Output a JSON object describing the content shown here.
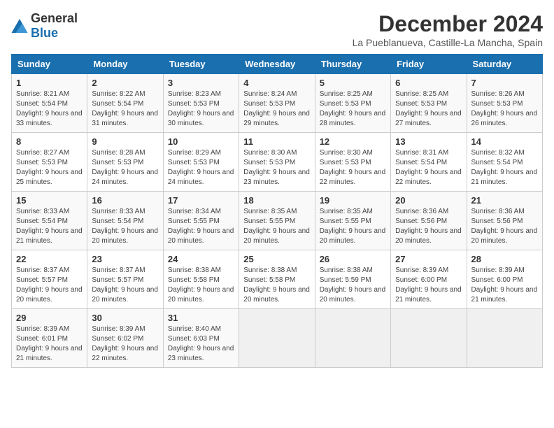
{
  "logo": {
    "general": "General",
    "blue": "Blue"
  },
  "header": {
    "title": "December 2024",
    "subtitle": "La Pueblanueva, Castille-La Mancha, Spain"
  },
  "weekdays": [
    "Sunday",
    "Monday",
    "Tuesday",
    "Wednesday",
    "Thursday",
    "Friday",
    "Saturday"
  ],
  "weeks": [
    [
      {
        "day": "1",
        "sunrise": "8:21 AM",
        "sunset": "5:54 PM",
        "daylight": "9 hours and 33 minutes."
      },
      {
        "day": "2",
        "sunrise": "8:22 AM",
        "sunset": "5:54 PM",
        "daylight": "9 hours and 31 minutes."
      },
      {
        "day": "3",
        "sunrise": "8:23 AM",
        "sunset": "5:53 PM",
        "daylight": "9 hours and 30 minutes."
      },
      {
        "day": "4",
        "sunrise": "8:24 AM",
        "sunset": "5:53 PM",
        "daylight": "9 hours and 29 minutes."
      },
      {
        "day": "5",
        "sunrise": "8:25 AM",
        "sunset": "5:53 PM",
        "daylight": "9 hours and 28 minutes."
      },
      {
        "day": "6",
        "sunrise": "8:25 AM",
        "sunset": "5:53 PM",
        "daylight": "9 hours and 27 minutes."
      },
      {
        "day": "7",
        "sunrise": "8:26 AM",
        "sunset": "5:53 PM",
        "daylight": "9 hours and 26 minutes."
      }
    ],
    [
      {
        "day": "8",
        "sunrise": "8:27 AM",
        "sunset": "5:53 PM",
        "daylight": "9 hours and 25 minutes."
      },
      {
        "day": "9",
        "sunrise": "8:28 AM",
        "sunset": "5:53 PM",
        "daylight": "9 hours and 24 minutes."
      },
      {
        "day": "10",
        "sunrise": "8:29 AM",
        "sunset": "5:53 PM",
        "daylight": "9 hours and 24 minutes."
      },
      {
        "day": "11",
        "sunrise": "8:30 AM",
        "sunset": "5:53 PM",
        "daylight": "9 hours and 23 minutes."
      },
      {
        "day": "12",
        "sunrise": "8:30 AM",
        "sunset": "5:53 PM",
        "daylight": "9 hours and 22 minutes."
      },
      {
        "day": "13",
        "sunrise": "8:31 AM",
        "sunset": "5:54 PM",
        "daylight": "9 hours and 22 minutes."
      },
      {
        "day": "14",
        "sunrise": "8:32 AM",
        "sunset": "5:54 PM",
        "daylight": "9 hours and 21 minutes."
      }
    ],
    [
      {
        "day": "15",
        "sunrise": "8:33 AM",
        "sunset": "5:54 PM",
        "daylight": "9 hours and 21 minutes."
      },
      {
        "day": "16",
        "sunrise": "8:33 AM",
        "sunset": "5:54 PM",
        "daylight": "9 hours and 20 minutes."
      },
      {
        "day": "17",
        "sunrise": "8:34 AM",
        "sunset": "5:55 PM",
        "daylight": "9 hours and 20 minutes."
      },
      {
        "day": "18",
        "sunrise": "8:35 AM",
        "sunset": "5:55 PM",
        "daylight": "9 hours and 20 minutes."
      },
      {
        "day": "19",
        "sunrise": "8:35 AM",
        "sunset": "5:55 PM",
        "daylight": "9 hours and 20 minutes."
      },
      {
        "day": "20",
        "sunrise": "8:36 AM",
        "sunset": "5:56 PM",
        "daylight": "9 hours and 20 minutes."
      },
      {
        "day": "21",
        "sunrise": "8:36 AM",
        "sunset": "5:56 PM",
        "daylight": "9 hours and 20 minutes."
      }
    ],
    [
      {
        "day": "22",
        "sunrise": "8:37 AM",
        "sunset": "5:57 PM",
        "daylight": "9 hours and 20 minutes."
      },
      {
        "day": "23",
        "sunrise": "8:37 AM",
        "sunset": "5:57 PM",
        "daylight": "9 hours and 20 minutes."
      },
      {
        "day": "24",
        "sunrise": "8:38 AM",
        "sunset": "5:58 PM",
        "daylight": "9 hours and 20 minutes."
      },
      {
        "day": "25",
        "sunrise": "8:38 AM",
        "sunset": "5:58 PM",
        "daylight": "9 hours and 20 minutes."
      },
      {
        "day": "26",
        "sunrise": "8:38 AM",
        "sunset": "5:59 PM",
        "daylight": "9 hours and 20 minutes."
      },
      {
        "day": "27",
        "sunrise": "8:39 AM",
        "sunset": "6:00 PM",
        "daylight": "9 hours and 21 minutes."
      },
      {
        "day": "28",
        "sunrise": "8:39 AM",
        "sunset": "6:00 PM",
        "daylight": "9 hours and 21 minutes."
      }
    ],
    [
      {
        "day": "29",
        "sunrise": "8:39 AM",
        "sunset": "6:01 PM",
        "daylight": "9 hours and 21 minutes."
      },
      {
        "day": "30",
        "sunrise": "8:39 AM",
        "sunset": "6:02 PM",
        "daylight": "9 hours and 22 minutes."
      },
      {
        "day": "31",
        "sunrise": "8:40 AM",
        "sunset": "6:03 PM",
        "daylight": "9 hours and 23 minutes."
      },
      null,
      null,
      null,
      null
    ]
  ]
}
